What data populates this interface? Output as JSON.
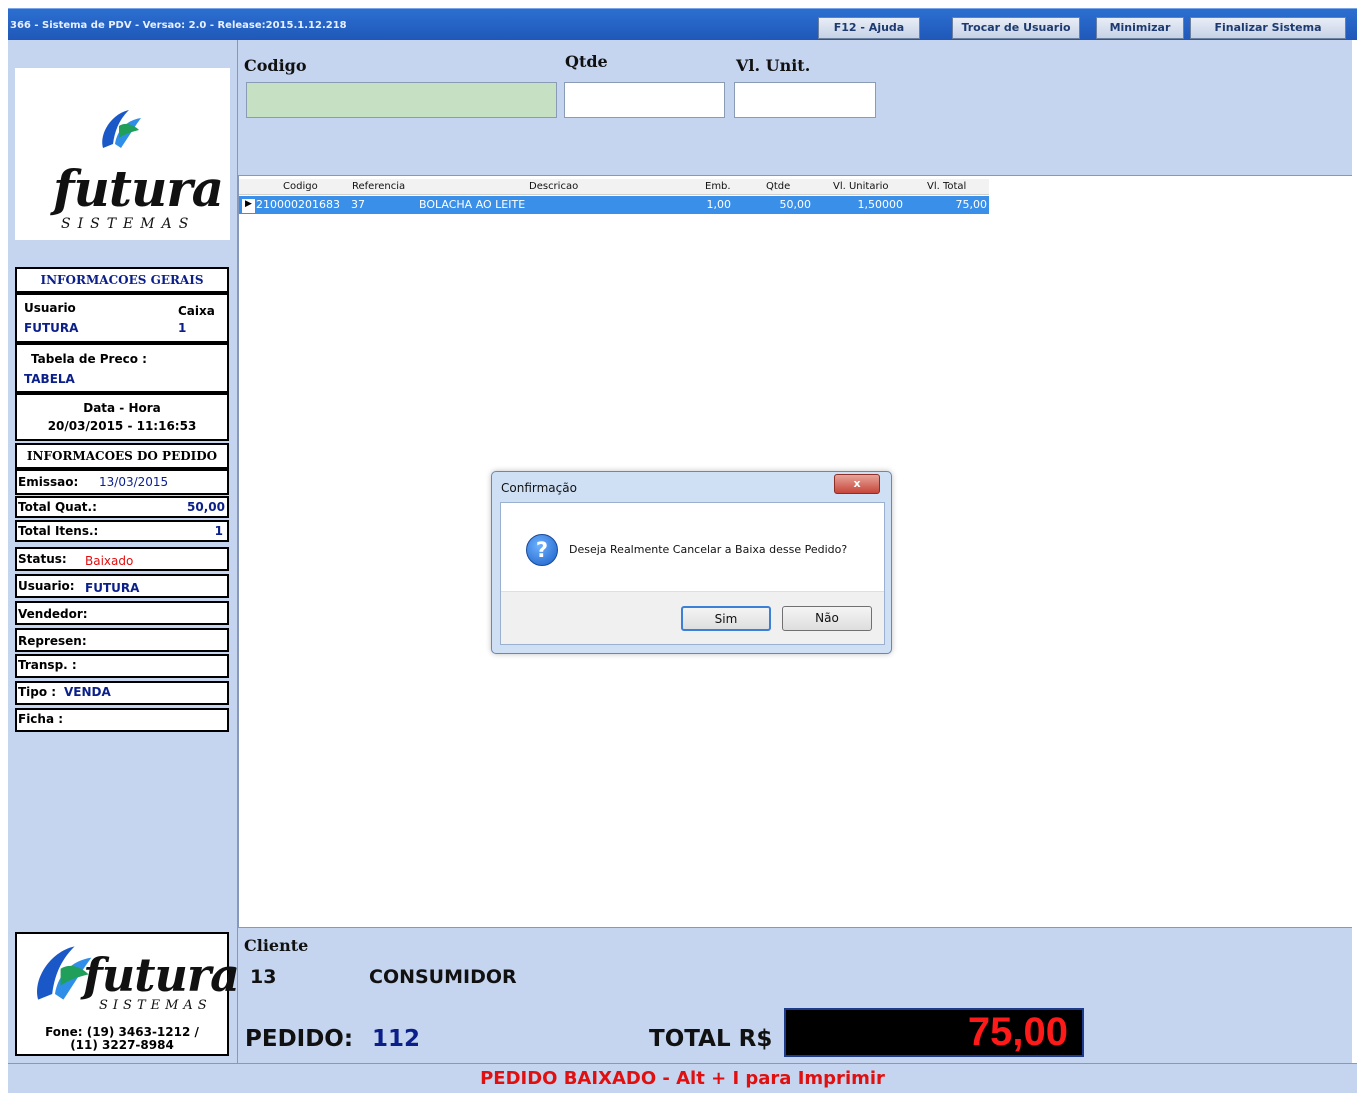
{
  "window": {
    "title": "366 - Sistema de PDV - Versao: 2.0 - Release:2015.1.12.218",
    "buttons": {
      "help": "F12 - Ajuda",
      "switch_user": "Trocar de Usuario",
      "minimize": "Minimizar",
      "exit": "Finalizar Sistema"
    }
  },
  "logo": {
    "name": "futura",
    "tagline": "SISTEMAS",
    "phone1": "Fone: (19) 3463-1212 /",
    "phone2": "(11) 3227-8984"
  },
  "info": {
    "section_title": "INFORMACOES GERAIS",
    "user_label": "Usuario",
    "user_value": "FUTURA",
    "caixa_label": "Caixa",
    "caixa_value": "1",
    "price_table_label": "Tabela de Preco :",
    "price_table_value": "TABELA",
    "datetime_label": "Data - Hora",
    "datetime_value": "20/03/2015 - 11:16:53"
  },
  "order": {
    "section_title": "INFORMACOES DO PEDIDO",
    "emissao_label": "Emissao:",
    "emissao_value": "13/03/2015",
    "total_quat_label": "Total Quat.:",
    "total_quat_value": "50,00",
    "total_itens_label": "Total Itens.:",
    "total_itens_value": "1",
    "status_label": "Status:",
    "status_value": "Baixado",
    "usuario_label": "Usuario:",
    "usuario_value": "FUTURA",
    "vendedor_label": "Vendedor:",
    "represen_label": "Represen:",
    "transp_label": "Transp. :",
    "tipo_label": "Tipo :",
    "tipo_value": "VENDA",
    "ficha_label": "Ficha :"
  },
  "entry": {
    "codigo_label": "Codigo",
    "qtde_label": "Qtde",
    "vlunit_label": "Vl. Unit."
  },
  "grid": {
    "columns": [
      "Codigo",
      "Referencia",
      "Descricao",
      "Emb.",
      "Qtde",
      "Vl. Unitario",
      "Vl. Total"
    ],
    "rows": [
      [
        "210000201683",
        "37",
        "BOLACHA AO LEITE",
        "1,00",
        "50,00",
        "1,50000",
        "75,00"
      ]
    ]
  },
  "dialog": {
    "title": "Confirmação",
    "close": "x",
    "message": "Deseja Realmente Cancelar a Baixa desse Pedido?",
    "yes": "Sim",
    "no": "Não"
  },
  "customer": {
    "label": "Cliente",
    "code": "13",
    "name": "CONSUMIDOR"
  },
  "totals": {
    "pedido_label": "PEDIDO:",
    "pedido_value": "112",
    "total_label": "TOTAL R$",
    "total_value": "75,00"
  },
  "status_bar": "PEDIDO BAIXADO - Alt + I para Imprimir",
  "colors": {
    "panel_bg": "#c5d5ef",
    "selected_row": "#3a8fe8",
    "code_field_bg": "#c6e0c3",
    "total_text": "#ff1a1a",
    "status_red": "#e01010",
    "value_blue": "#0b1f8a"
  },
  "icons": {
    "logo": "futura-logo-icon",
    "dialog_question": "question-icon",
    "row_pointer": "row-pointer-icon"
  }
}
